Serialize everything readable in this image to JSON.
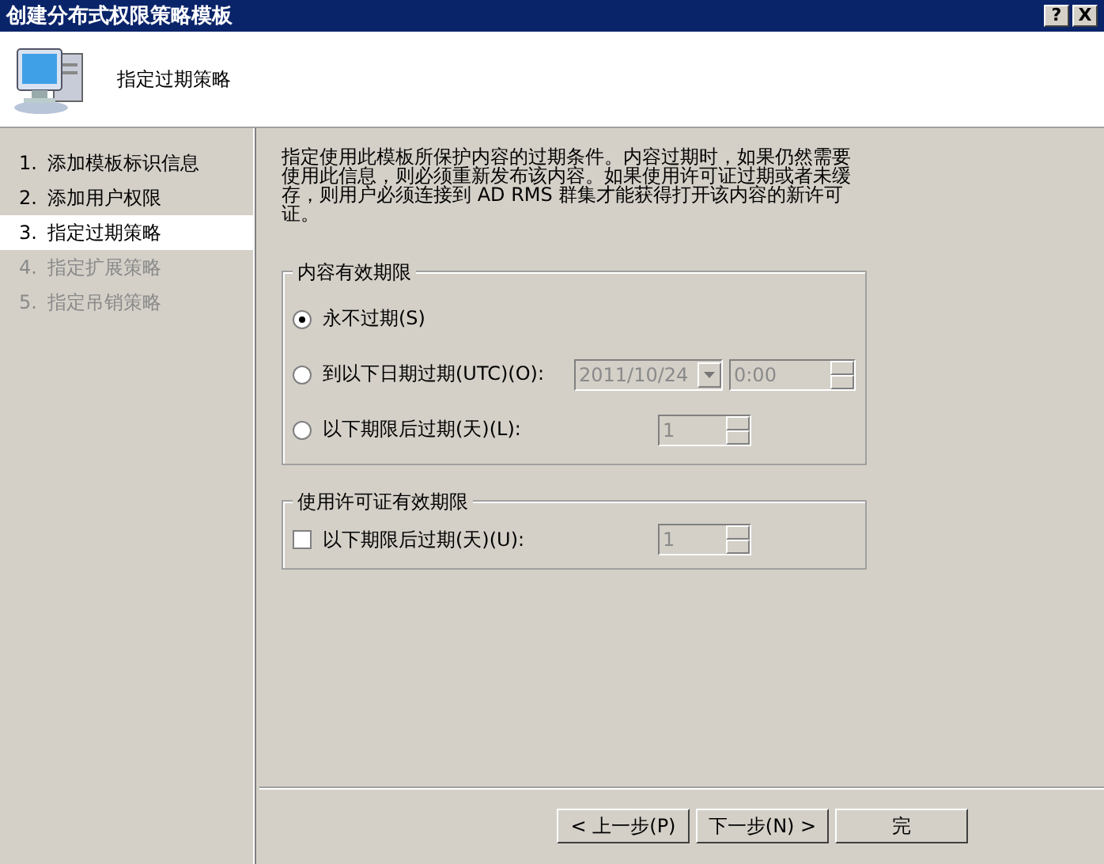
{
  "window": {
    "title": "创建分布式权限策略模板",
    "controls": [
      "?",
      "X"
    ]
  },
  "header": {
    "title": "指定过期策略"
  },
  "steps": [
    {
      "number": "1.",
      "label": "添加模板标识信息",
      "selected": false,
      "disabled": false
    },
    {
      "number": "2.",
      "label": "添加用户权限",
      "selected": false,
      "disabled": false
    },
    {
      "number": "3.",
      "label": "指定过期策略",
      "selected": true,
      "disabled": false
    },
    {
      "number": "4.",
      "label": "指定扩展策略",
      "selected": false,
      "disabled": true
    },
    {
      "number": "5.",
      "label": "指定吊销策略",
      "selected": false,
      "disabled": true
    }
  ],
  "description": "指定使用此模板所保护内容的过期条件。内容过期时，如果仍然需要使用此信息，则必须重新发布该内容。如果使用许可证过期或者未缓存，则用户必须连接到 AD RMS 群集才能获得打开该内容的新许可证。",
  "groups": [
    {
      "title": "内容有效期限",
      "options": [
        {
          "kind": "radio",
          "label": "永不过期(S)",
          "selected": true
        },
        {
          "kind": "radio",
          "label": "到以下日期过期(UTC)(O):",
          "selected": false,
          "controls": [
            {
              "kind": "dropdown",
              "value": "2011/10/24",
              "disabled": true
            },
            {
              "kind": "spinner",
              "value": "0:00",
              "disabled": true
            }
          ]
        },
        {
          "kind": "radio",
          "label": "以下期限后过期(天)(L):",
          "selected": false,
          "controls": [
            {
              "kind": "spinner",
              "value": "1",
              "disabled": true
            }
          ]
        }
      ]
    },
    {
      "title": "使用许可证有效期限",
      "options": [
        {
          "kind": "checkbox",
          "label": "以下期限后过期(天)(U):",
          "checked": false,
          "controls": [
            {
              "kind": "spinner",
              "value": "1",
              "disabled": true
            }
          ]
        }
      ]
    }
  ],
  "buttons": [
    {
      "label": "< 上一步(P)"
    },
    {
      "label": "下一步(N) >"
    },
    {
      "label": "完"
    }
  ]
}
